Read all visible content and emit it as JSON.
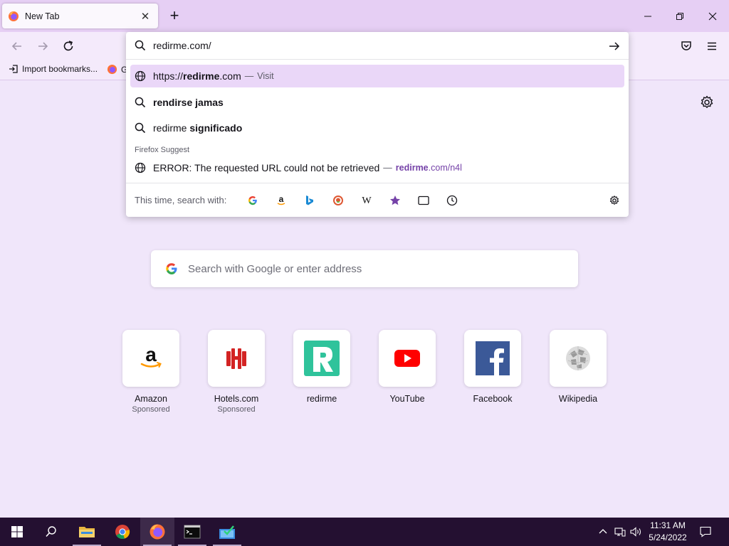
{
  "tab": {
    "title": "New Tab",
    "close_glyph": "✕"
  },
  "toolbar": {
    "new_tab_glyph": "+"
  },
  "bookmarks": {
    "import_label": "Import bookmarks...",
    "second_label": "G"
  },
  "urlbar": {
    "value": "redirme.com/",
    "results": [
      {
        "type": "visit",
        "prefix": "https://",
        "bold": "redirme",
        "suffix": ".com",
        "sep": "—",
        "action": "Visit"
      },
      {
        "type": "search",
        "bold": "rendirse jamas"
      },
      {
        "type": "search",
        "plain": "redirme ",
        "bold": "significado"
      }
    ],
    "group_label": "Firefox Suggest",
    "suggest": {
      "text": "ERROR: The requested URL could not be retrieved",
      "sep": "—",
      "url_bold": "redirme",
      "url_rest": ".com/n4l"
    },
    "oneoff_label": "This time, search with:",
    "engines": [
      "google-icon",
      "amazon-icon",
      "bing-icon",
      "duckduckgo-icon",
      "wikipedia-icon",
      "bookmarks-icon",
      "tabs-icon",
      "history-icon"
    ]
  },
  "center_search": {
    "placeholder": "Search with Google or enter address"
  },
  "top_sites": [
    {
      "title": "Amazon",
      "sub": "Sponsored",
      "icon": "amazon-logo"
    },
    {
      "title": "Hotels.com",
      "sub": "Sponsored",
      "icon": "hotels-logo"
    },
    {
      "title": "redirme",
      "sub": "",
      "icon": "redirme-logo"
    },
    {
      "title": "YouTube",
      "sub": "",
      "icon": "youtube-logo"
    },
    {
      "title": "Facebook",
      "sub": "",
      "icon": "facebook-logo"
    },
    {
      "title": "Wikipedia",
      "sub": "",
      "icon": "wikipedia-logo"
    }
  ],
  "taskbar": {
    "time": "11:31 AM",
    "date": "5/24/2022"
  },
  "colors": {
    "accent": "#7542a8",
    "selected_row": "#ead7f8",
    "tabstrip": "#e6cff4",
    "page_bg": "#f0e6fa",
    "taskbar": "#241031"
  }
}
